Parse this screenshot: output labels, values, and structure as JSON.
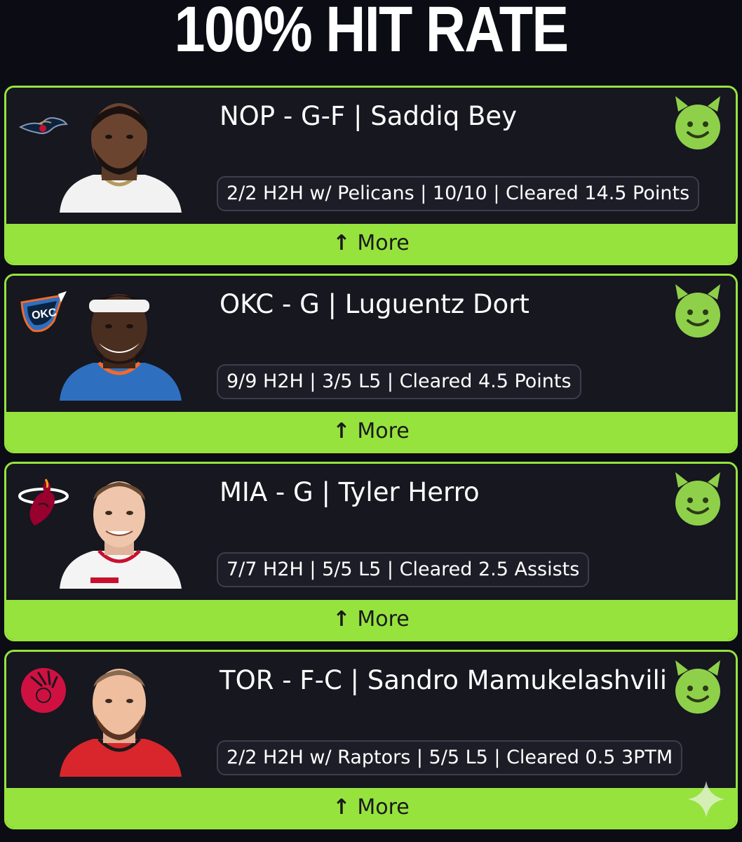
{
  "page": {
    "title": "100% HIT RATE"
  },
  "colors": {
    "accent": "#96e33e",
    "background": "#0b0c14",
    "card": "#16171f"
  },
  "cards": [
    {
      "team": "NOP",
      "team_logo_icon": "pelicans-logo-icon",
      "headline": "NOP - G-F | Saddiq Bey",
      "stat": "2/2 H2H w/ Pelicans | 10/10 | Cleared 14.5 Points",
      "more_label": "More",
      "jersey_color": "#f2f2f2",
      "jersey_trim": "#b49a5e"
    },
    {
      "team": "OKC",
      "team_logo_icon": "thunder-logo-icon",
      "headline": "OKC - G | Luguentz Dort",
      "stat": "9/9 H2H | 3/5 L5 | Cleared 4.5 Points",
      "more_label": "More",
      "jersey_color": "#2f6fc0",
      "jersey_trim": "#f26a2a"
    },
    {
      "team": "MIA",
      "team_logo_icon": "heat-logo-icon",
      "headline": "MIA - G | Tyler Herro",
      "stat": "7/7 H2H | 5/5 L5 | Cleared 2.5 Assists",
      "more_label": "More",
      "jersey_color": "#f4f4f4",
      "jersey_trim": "#c8102e"
    },
    {
      "team": "TOR",
      "team_logo_icon": "raptors-logo-icon",
      "headline": "TOR - F-C | Sandro Mamukelashvili",
      "stat": "2/2 H2H w/ Raptors | 5/5 L5 | Cleared 0.5 3PTM",
      "more_label": "More",
      "jersey_color": "#d8262c",
      "jersey_trim": "#ffffff"
    }
  ]
}
